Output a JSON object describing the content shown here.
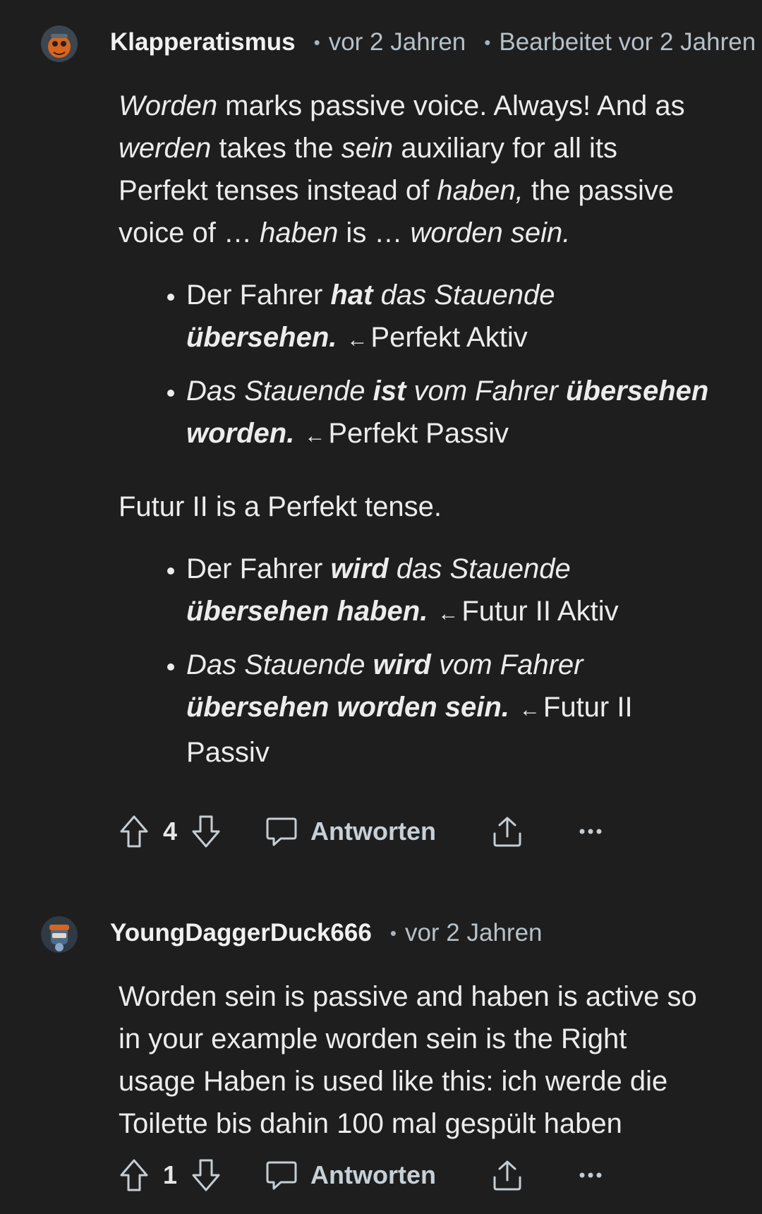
{
  "comments": [
    {
      "username": "Klapperatismus",
      "time": "vor 2 Jahren",
      "edited": "Bearbeitet vor 2 Jahren",
      "body": {
        "intro": {
          "p1_i1": "Worden",
          "p1_t1": " marks passive voice. Always! And as ",
          "p1_i2": "werden",
          "p1_t2": " takes the ",
          "p1_i3": "sein",
          "p1_t3": " auxiliary for all its Perfekt tenses instead of ",
          "p1_i4": "haben,",
          "p1_t4": " the passive voice of … ",
          "p1_i5": "haben",
          "p1_t5": " is … ",
          "p1_i6": "worden sein."
        },
        "list1": [
          {
            "a": "Der Fahrer ",
            "b": "hat",
            "c": " das Stauende ",
            "d": "übersehen.",
            "arrow": "←",
            "label": "Perfekt Aktiv"
          },
          {
            "a": "Das Stauende ",
            "b": "ist",
            "c": " vom Fahrer ",
            "d": "übersehen worden.",
            "arrow": "←",
            "label": "Perfekt Passiv"
          }
        ],
        "middle": "Futur II is a Perfekt tense.",
        "list2": [
          {
            "a": "Der Fahrer ",
            "b": "wird",
            "c": " das Stauende ",
            "d": "übersehen haben.",
            "arrow": "←",
            "label": "Futur II Aktiv"
          },
          {
            "a": "Das Stauende ",
            "b": "wird",
            "c": " vom Fahrer ",
            "d": "übersehen worden sein.",
            "arrow": "←",
            "label": "Futur II Passiv"
          }
        ]
      },
      "votes": "4",
      "reply_label": "Antworten",
      "icons": [
        "upvote-icon",
        "downvote-icon",
        "comment-icon",
        "share-icon",
        "more-icon"
      ]
    },
    {
      "username": "YoungDaggerDuck666",
      "time": "vor 2 Jahren",
      "body": "Worden sein is passive and haben is active so in your example worden sein is the Right usage Haben is used like this: ich werde die Toilette bis dahin 100 mal gespült haben",
      "votes": "1",
      "reply_label": "Antworten"
    }
  ],
  "colors": {
    "background": "#1e1e1e",
    "text": "#ececec",
    "meta": "#b6c0c8"
  }
}
